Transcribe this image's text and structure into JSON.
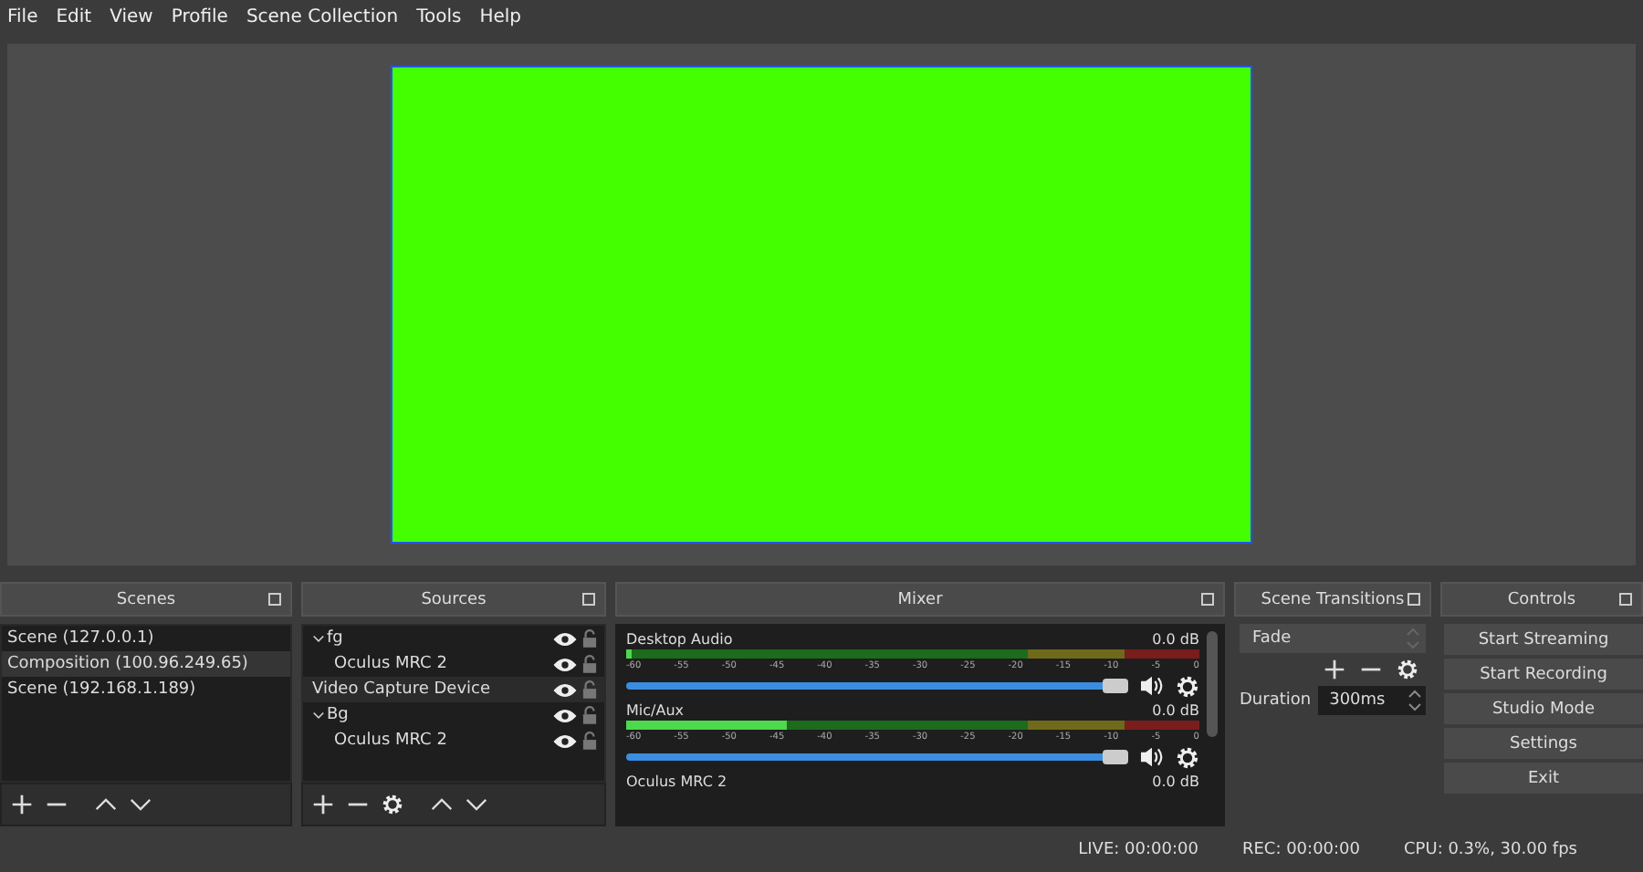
{
  "menu": [
    "File",
    "Edit",
    "View",
    "Profile",
    "Scene Collection",
    "Tools",
    "Help"
  ],
  "preview": {
    "kind": "solid",
    "color": "#44ff00"
  },
  "scenes": {
    "title": "Scenes",
    "items": [
      {
        "label": "Scene (127.0.0.1)",
        "selected": false
      },
      {
        "label": "Composition (100.96.249.65)",
        "selected": true
      },
      {
        "label": "Scene (192.168.1.189)",
        "selected": false
      }
    ]
  },
  "sources": {
    "title": "Sources",
    "items": [
      {
        "label": "fg",
        "selected": false,
        "visible": true,
        "locked": false,
        "expanded": true,
        "children": [
          {
            "label": "Oculus MRC 2",
            "selected": false,
            "visible": true,
            "locked": false
          }
        ]
      },
      {
        "label": "Video Capture Device",
        "selected": true,
        "visible": true,
        "locked": false
      },
      {
        "label": "Bg",
        "selected": false,
        "visible": true,
        "locked": false,
        "expanded": true,
        "children": [
          {
            "label": "Oculus MRC 2",
            "selected": false,
            "visible": true,
            "locked": false
          }
        ]
      }
    ]
  },
  "mixer": {
    "title": "Mixer",
    "channels": [
      {
        "name": "Desktop Audio",
        "reading": "0.0 dB",
        "meter": {
          "level": 0.01
        },
        "volume": {
          "level": 1
        },
        "muted": false,
        "scale": [
          "-60",
          "-55",
          "-50",
          "-45",
          "-40",
          "-35",
          "-30",
          "-25",
          "-20",
          "-15",
          "-10",
          "-5",
          "0"
        ]
      },
      {
        "name": "Mic/Aux",
        "reading": "0.0 dB",
        "meter": {
          "level": 0.28
        },
        "volume": {
          "level": 1
        },
        "muted": false,
        "scale": [
          "-60",
          "-55",
          "-50",
          "-45",
          "-40",
          "-35",
          "-30",
          "-25",
          "-20",
          "-15",
          "-10",
          "-5",
          "0"
        ]
      },
      {
        "name": "Oculus MRC 2",
        "reading": "0.0 dB"
      }
    ]
  },
  "transitions": {
    "title": "Scene Transitions",
    "transition": "Fade",
    "duration_label": "Duration",
    "duration": "300ms"
  },
  "controls": {
    "title": "Controls",
    "buttons": [
      "Start Streaming",
      "Start Recording",
      "Studio Mode",
      "Settings",
      "Exit"
    ]
  },
  "status_bar": [
    "LIVE: 00:00:00",
    "REC: 00:00:00",
    "CPU: 0.3%, 30.00 fps"
  ]
}
